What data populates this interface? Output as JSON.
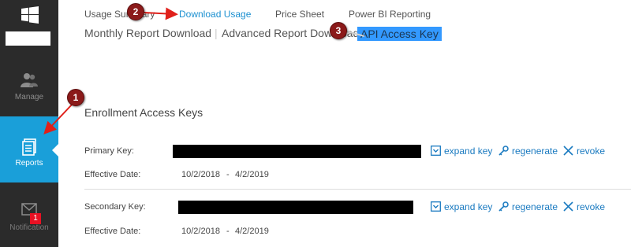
{
  "sidebar": {
    "items": [
      {
        "label": "Manage",
        "icon": "people-icon"
      },
      {
        "label": "Reports",
        "icon": "report-icon"
      },
      {
        "label": "Notification",
        "icon": "mail-icon",
        "badge": "1"
      }
    ]
  },
  "nav": {
    "row1": [
      "Usage Summary",
      "Download Usage",
      "Price Sheet",
      "Power BI Reporting"
    ],
    "row2": [
      "Monthly Report Download",
      "Advanced Report Download",
      "API Access Key"
    ],
    "separator": "|"
  },
  "callouts": [
    "1",
    "2",
    "3"
  ],
  "section_title": "Enrollment Access Keys",
  "keys": [
    {
      "label": "Primary Key:",
      "effective_label": "Effective Date:",
      "start": "10/2/2018",
      "dash": "-",
      "end": "4/2/2019",
      "actions": [
        "expand key",
        "regenerate",
        "revoke"
      ]
    },
    {
      "label": "Secondary Key:",
      "effective_label": "Effective Date:",
      "start": "10/2/2018",
      "dash": "-",
      "end": "4/2/2019",
      "actions": [
        "expand key",
        "regenerate",
        "revoke"
      ]
    }
  ],
  "colors": {
    "sidebar": "#2b2b2b",
    "active": "#1a9fd9",
    "link": "#1a7ac0",
    "highlight": "#3399ff",
    "callout": "#8b1a1a",
    "arrow": "#e0201a",
    "badge": "#e81123"
  }
}
